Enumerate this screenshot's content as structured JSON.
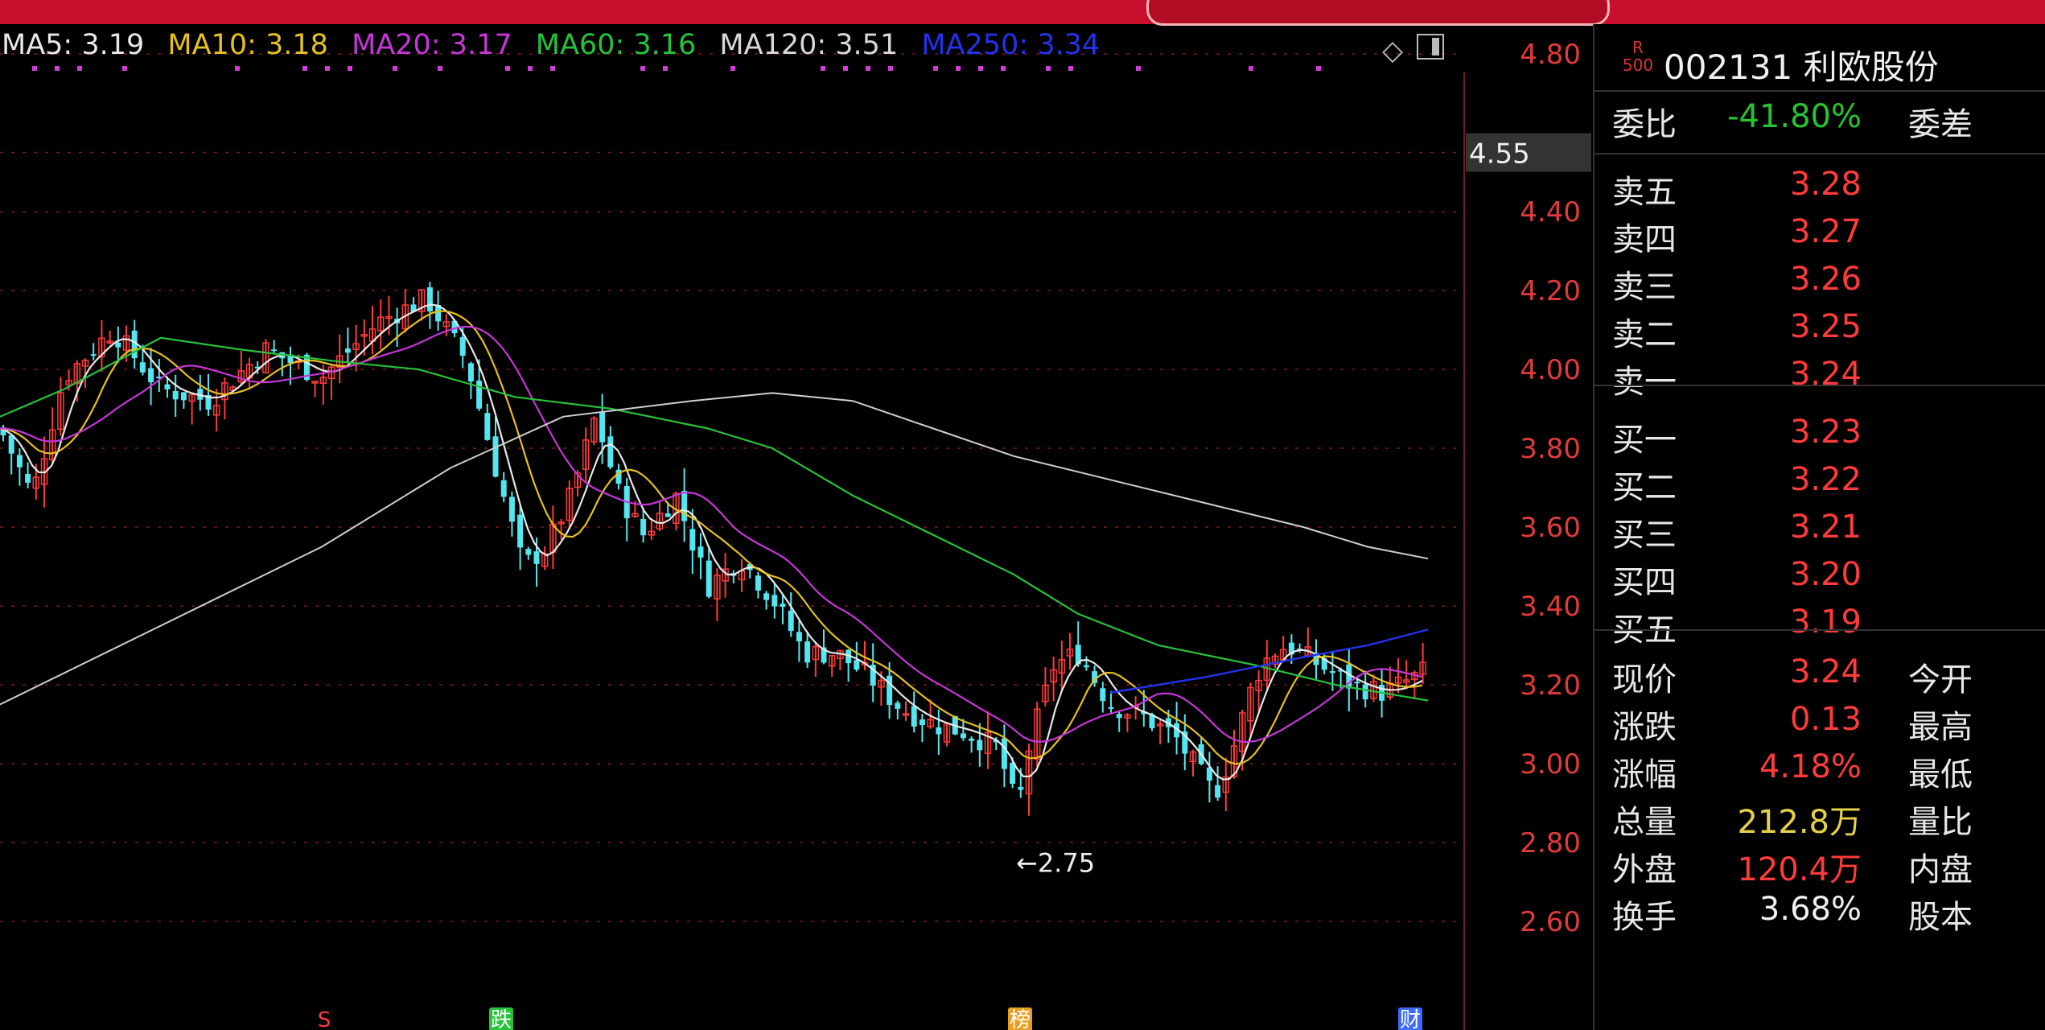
{
  "stock": {
    "code": "002131",
    "name": "利欧股份",
    "badge_top": "R",
    "badge_bottom": "500"
  },
  "legend": [
    {
      "label": "MA5: 3.19",
      "color": "#e8e8e8"
    },
    {
      "label": "MA10: 3.18",
      "color": "#e6c020"
    },
    {
      "label": "MA20: 3.17",
      "color": "#c636d8"
    },
    {
      "label": "MA60: 3.16",
      "color": "#26c23a"
    },
    {
      "label": "MA120: 3.51",
      "color": "#d8d8d8"
    },
    {
      "label": "MA250: 3.34",
      "color": "#2233ee"
    }
  ],
  "axis": {
    "ticks": [
      "4.80",
      "4.40",
      "4.20",
      "4.00",
      "3.80",
      "3.60",
      "3.40",
      "3.20",
      "3.00",
      "2.80",
      "2.60"
    ],
    "current_marker": "4.55"
  },
  "annotations": {
    "low": "←2.75",
    "markers": [
      "S",
      "跌",
      "榜",
      "财"
    ]
  },
  "quote": {
    "webi": {
      "label": "委比",
      "value": "-41.80%",
      "label2": "委差"
    },
    "sell": [
      {
        "label": "卖五",
        "price": "3.28"
      },
      {
        "label": "卖四",
        "price": "3.27"
      },
      {
        "label": "卖三",
        "price": "3.26"
      },
      {
        "label": "卖二",
        "price": "3.25"
      },
      {
        "label": "卖一",
        "price": "3.24"
      }
    ],
    "buy": [
      {
        "label": "买一",
        "price": "3.23"
      },
      {
        "label": "买二",
        "price": "3.22"
      },
      {
        "label": "买三",
        "price": "3.21"
      },
      {
        "label": "买四",
        "price": "3.20"
      },
      {
        "label": "买五",
        "price": "3.19"
      }
    ],
    "stats": [
      {
        "label": "现价",
        "value": "3.24",
        "label2": "今开"
      },
      {
        "label": "涨跌",
        "value": "0.13",
        "label2": "最高"
      },
      {
        "label": "涨幅",
        "value": "4.18%",
        "label2": "最低"
      },
      {
        "label": "总量",
        "value": "212.8万",
        "label2": "量比"
      },
      {
        "label": "外盘",
        "value": "120.4万",
        "label2": "内盘"
      },
      {
        "label": "换手",
        "value": "3.68%",
        "label2": "股本"
      }
    ]
  },
  "colors": {
    "up": "#ff3b3b",
    "down": "#54e6f0",
    "axis_text": "#e03a3a",
    "grid": "#7a1a1a"
  }
}
